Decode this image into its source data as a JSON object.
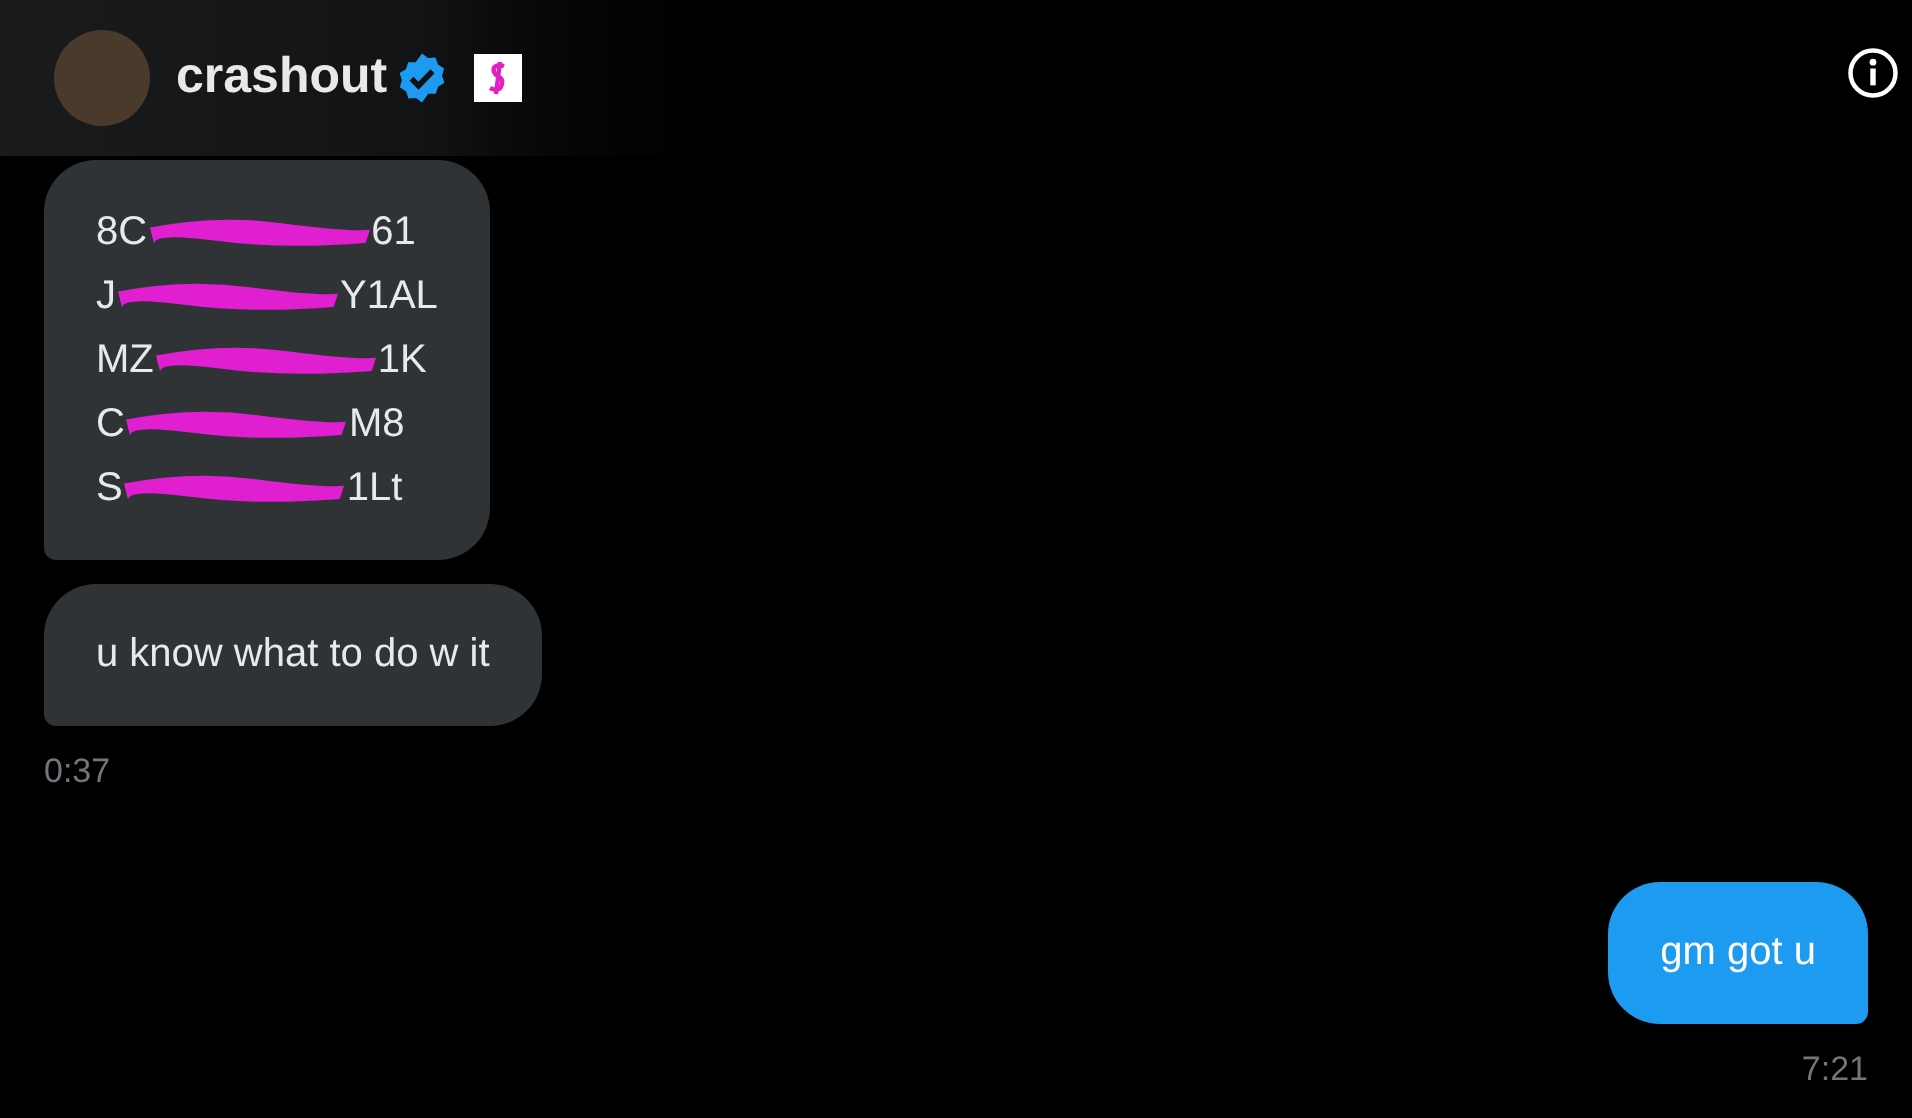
{
  "header": {
    "name": "crashout"
  },
  "messages": [
    {
      "kind": "redacted",
      "outgoing": false,
      "lines": [
        {
          "start": "8C",
          "end": "61"
        },
        {
          "start": "J",
          "end": "Y1AL"
        },
        {
          "start": "MZ",
          "end": "1K"
        },
        {
          "start": "C",
          "end": "M8"
        },
        {
          "start": "S",
          "end": "1Lt"
        }
      ]
    },
    {
      "kind": "text",
      "outgoing": false,
      "text": "u know what to do w it",
      "time": "0:37"
    },
    {
      "kind": "text",
      "outgoing": true,
      "text": "gm got u",
      "time": "7:21"
    }
  ]
}
